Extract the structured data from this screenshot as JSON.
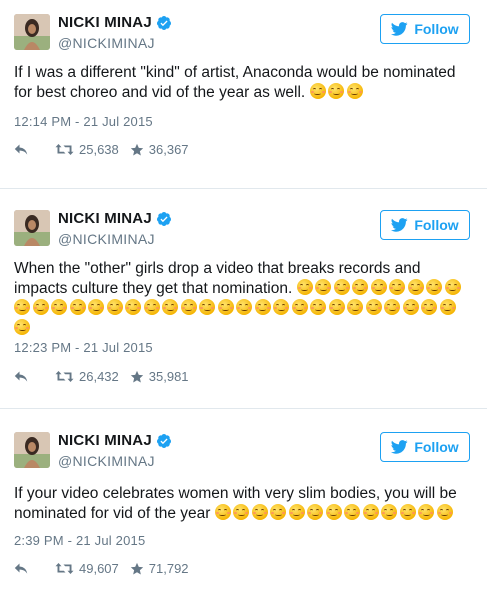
{
  "tweets": [
    {
      "name": "NICKI MINAJ",
      "handle": "@NICKIMINAJ",
      "follow_label": "Follow",
      "text": "If I was a different \"kind\" of artist, Anaconda would be nominated for best choreo and vid of the year as well.",
      "emoji_count": 3,
      "timestamp": "12:14 PM - 21 Jul 2015",
      "retweets": "25,638",
      "likes": "36,367"
    },
    {
      "name": "NICKI MINAJ",
      "handle": "@NICKIMINAJ",
      "follow_label": "Follow",
      "text": "When the \"other\" girls drop a video that breaks records and impacts culture they get that nomination.",
      "emoji_count": 34,
      "timestamp": "12:23 PM - 21 Jul 2015",
      "retweets": "26,432",
      "likes": "35,981"
    },
    {
      "name": "NICKI MINAJ",
      "handle": "@NICKIMINAJ",
      "follow_label": "Follow",
      "text": "If your video celebrates women with very slim bodies, you will be nominated for vid of the year",
      "emoji_count": 13,
      "timestamp": "2:39 PM - 21 Jul 2015",
      "retweets": "49,607",
      "likes": "71,792"
    }
  ],
  "colors": {
    "twitter_blue": "#1da1f2",
    "verified_blue": "#1da1f2",
    "muted_text": "#657786",
    "divider": "#e1e8ed"
  },
  "icons": {
    "verified": "verified-badge-icon",
    "follow": "twitter-bird-icon",
    "reply": "reply-arrow-icon",
    "retweet": "retweet-icon",
    "like": "star-icon",
    "emoji": "blushing-smile-emoji"
  }
}
